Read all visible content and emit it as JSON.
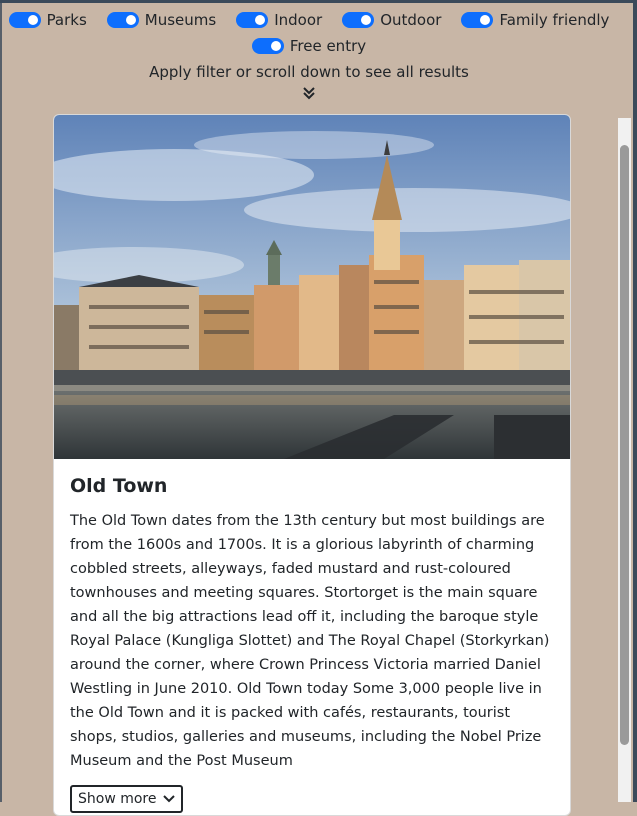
{
  "filters": {
    "row1": [
      "Parks",
      "Museums",
      "Indoor",
      "Outdoor",
      "Family friendly"
    ],
    "row2": [
      "Free entry"
    ],
    "hint": "Apply filter or scroll down to see all results",
    "toggle_color": "#0d6efd"
  },
  "card": {
    "title": "Old Town",
    "description": "The Old Town dates from the 13th century but most buildings are from the 1600s and 1700s. It is a glorious labyrinth of charming cobbled streets, alleyways, faded mustard and rust-coloured townhouses and meeting squares. Stortorget is the main square and all the big attractions lead off it, including the baroque style Royal Palace (Kungliga Slottet) and The Royal Chapel (Storkyrkan) around the corner, where Crown Princess Victoria married Daniel Westling in June 2010. Old Town today Some 3,000 people live in the Old Town and it is packed with cafés, restaurants, tourist shops, studios, galleries and museums, including the Nobel Prize Museum and the Post Museum",
    "show_more_label": "Show more",
    "show_more_icon": "chevron-down-icon"
  },
  "colors": {
    "page_background": "#c8b6a6",
    "accent": "#0d6efd"
  }
}
